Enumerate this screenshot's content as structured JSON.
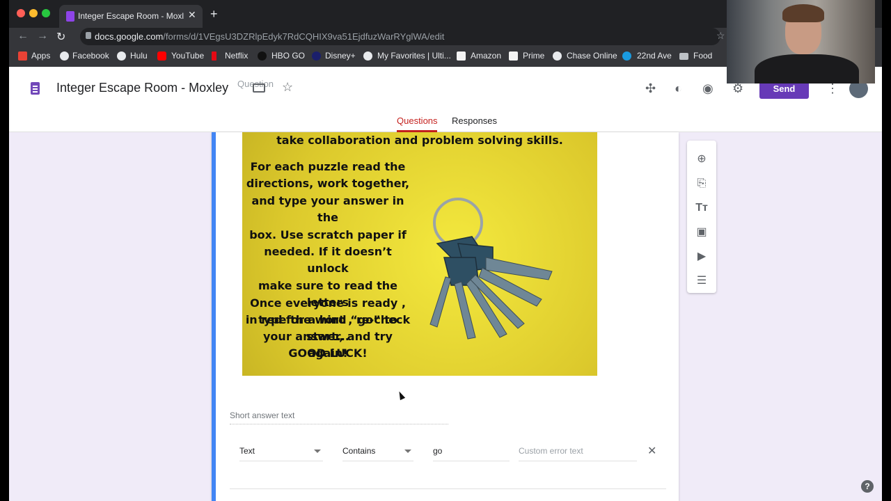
{
  "browser": {
    "tab_title": "Integer Escape Room - Moxley",
    "url_host": "docs.google.com",
    "url_path": "/forms/d/1VEgsU3DZRlpEdyk7RdCQHIX9va51EjdfuzWarRYglWA/edit",
    "bookmarks": [
      "Apps",
      "Facebook",
      "Hulu",
      "YouTube",
      "Netflix",
      "HBO GO",
      "Disney+",
      "My Favorites | Ulti...",
      "Amazon",
      "Prime",
      "Chase Online",
      "22nd Ave",
      "Food"
    ],
    "colors": {
      "close": "#ff5f57",
      "minimize": "#febc2e",
      "zoom": "#28c840"
    }
  },
  "form": {
    "title": "Integer Escape Room - Moxley",
    "ghost_label": "Question",
    "send_label": "Send",
    "tabs": {
      "questions": "Questions",
      "responses": "Responses"
    },
    "accent": "#673ab7"
  },
  "poster": {
    "top_line": "take collaboration and problem solving skills.",
    "body": "For each puzzle read the\ndirections, work together,\nand type your answer in the\nbox. Use scratch paper if\nneeded. If it doesn’t unlock\nmake sure to read the letters\nin red for a hint , re-check\nyour answer, and try again!",
    "body2": "Once everyone is ready ,\ntype the word “go” to\nstart...\nGOOD LUCK!"
  },
  "question": {
    "short_answer_placeholder": "Short answer text",
    "validation": {
      "type": "Text",
      "condition": "Contains",
      "value": "go",
      "error_placeholder": "Custom error text"
    }
  },
  "side_toolbar": [
    "add-question-icon",
    "import-questions-icon",
    "add-title-icon",
    "add-image-icon",
    "add-video-icon",
    "add-section-icon"
  ],
  "help_label": "?"
}
